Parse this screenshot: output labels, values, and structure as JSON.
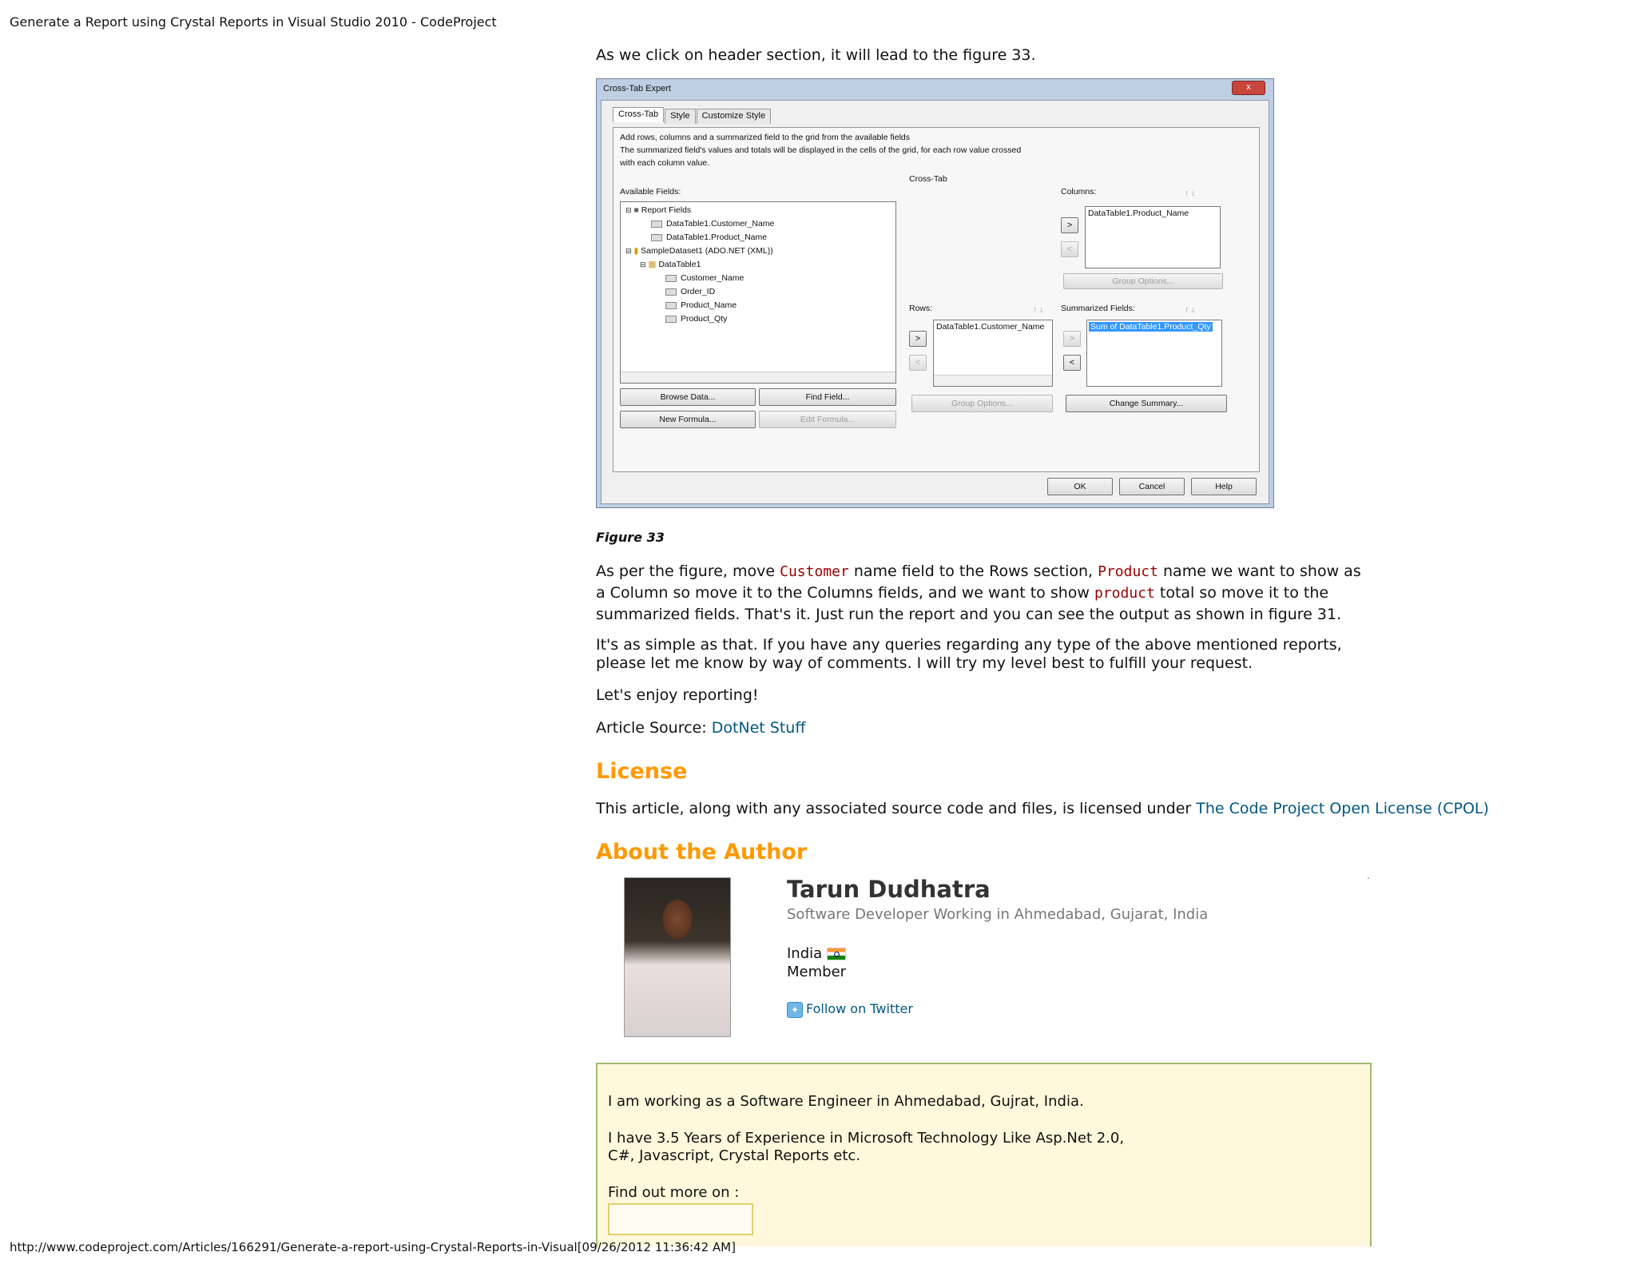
{
  "page_header": "Generate a Report using Crystal Reports in Visual Studio 2010 - CodeProject",
  "page_footer": "http://www.codeproject.com/Articles/166291/Generate-a-report-using-Crystal-Reports-in-Visual[09/26/2012 11:36:42 AM]",
  "intro": "As we click on header section, it will lead to the figure 33.",
  "dialog": {
    "title": "Cross-Tab Expert",
    "close": "x",
    "tabs": [
      "Cross-Tab",
      "Style",
      "Customize Style"
    ],
    "desc1": "Add rows, columns and a summarized field to the grid from the available fields",
    "desc2": "The summarized field's values and totals will be displayed in the cells of the grid, for each row value crossed",
    "desc3": "with each column value.",
    "available_label": "Available Fields:",
    "crosstab_label": "Cross-Tab",
    "columns_label": "Columns:",
    "rows_label": "Rows:",
    "summarized_label": "Summarized Fields:",
    "tree": [
      "Report Fields",
      "DataTable1.Customer_Name",
      "DataTable1.Product_Name",
      "SampleDataset1 (ADO.NET (XML))",
      "DataTable1",
      "Customer_Name",
      "Order_ID",
      "Product_Name",
      "Product_Qty"
    ],
    "columns_value": "DataTable1.Product_Name",
    "rows_value": "DataTable1.Customer_Name",
    "summarized_value": "Sum of DataTable1.Product_Qty",
    "btn_browse": "Browse Data...",
    "btn_find": "Find Field...",
    "btn_new_formula": "New Formula...",
    "btn_edit_formula": "Edit Formula...",
    "btn_group_options": "Group Options...",
    "btn_change_summary": "Change Summary...",
    "btn_ok": "OK",
    "btn_cancel": "Cancel",
    "btn_help": "Help",
    "arrow_right": ">",
    "arrow_left": "<",
    "up_down": "↑ ↓"
  },
  "figure_caption": "Figure 33",
  "para1": {
    "t1": "As per the figure, move ",
    "k1": "Customer",
    "t2": " name field to the Rows section, ",
    "k2": "Product",
    "t3": " name we want to show as a Column so move it to the Columns fields, and we want to show ",
    "k3": "product",
    "t4": " total so move it to the summarized fields. That's it. Just run the report and you can see the output as shown in figure 31."
  },
  "para2": "It's as simple as that. If you have any queries regarding any type of the above mentioned reports, please let me know by way of comments. I will try my level best to fulfill your request.",
  "para3": "Let's enjoy reporting!",
  "source_label": "Article Source: ",
  "source_link": "DotNet Stuff",
  "license_heading": "License",
  "license_text": "This article, along with any associated source code and files, is licensed under ",
  "license_link": "The Code Project Open License (CPOL)",
  "about_heading": "About the Author",
  "author": {
    "name": "Tarun Dudhatra",
    "job": "Software Developer Working in Ahmedabad, Gujarat, India",
    "country": "India",
    "role": "Member",
    "twitter": "Follow on Twitter",
    "twitter_icon": "twitter-bird-icon",
    "flag_icon": "india-flag-icon"
  },
  "bio": {
    "line1": "I am working as a Software Engineer in Ahmedabad, Gujrat, India.",
    "line2": "I have 3.5 Years of Experience in Microsoft Technology Like Asp.Net 2.0,",
    "line3": "C#, Javascript, Crystal Reports etc.",
    "line4": "Find out more on :"
  },
  "colors": {
    "heading": "#ff9900",
    "link": "#005782",
    "code": "#990000",
    "bio_bg": "#fff8dc",
    "bio_border": "#9fbd6e"
  }
}
